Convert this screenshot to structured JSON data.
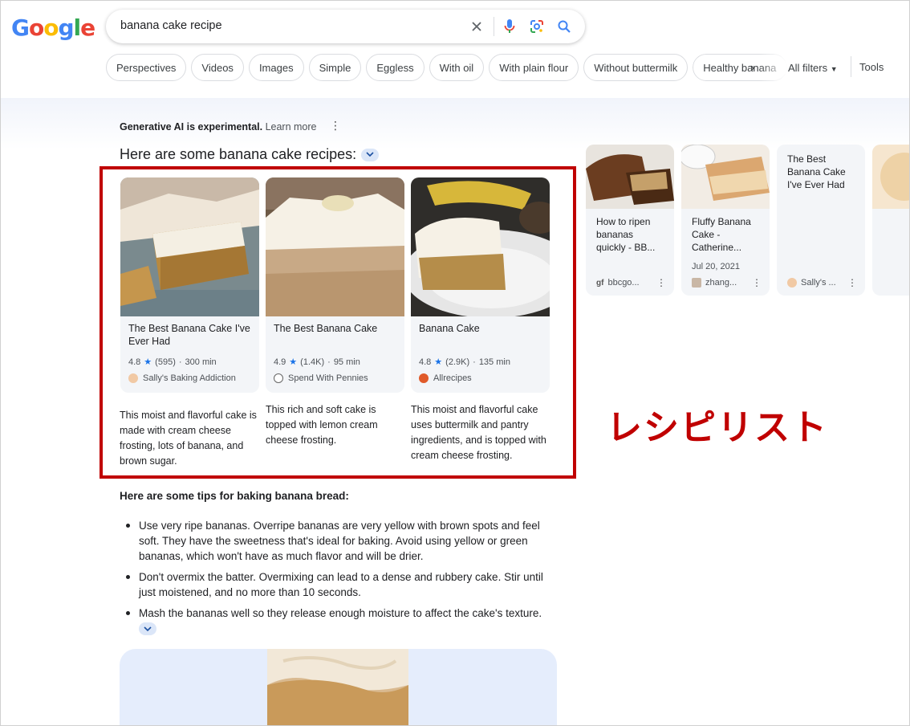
{
  "search": {
    "query": "banana cake recipe"
  },
  "chips": [
    "Perspectives",
    "Videos",
    "Images",
    "Simple",
    "Eggless",
    "With oil",
    "With plain flour",
    "Without buttermilk",
    "Healthy banana"
  ],
  "filters": {
    "all_filters": "All filters",
    "tools": "Tools"
  },
  "ai_overview": {
    "notice_bold": "Generative AI is experimental.",
    "notice_link": "Learn more",
    "heading": "Here are some banana cake recipes:"
  },
  "recipes": [
    {
      "title": "The Best Banana Cake I've Ever Had",
      "rating": "4.8",
      "reviews": "(595)",
      "time": "300 min",
      "source": "Sally's Baking Addiction",
      "description": "This moist and flavorful cake is made with cream cheese frosting, lots of banana, and brown sugar."
    },
    {
      "title": "The Best Banana Cake",
      "rating": "4.9",
      "reviews": "(1.4K)",
      "time": "95 min",
      "source": "Spend With Pennies",
      "description": "This rich and soft cake is topped with lemon cream cheese frosting."
    },
    {
      "title": "Banana Cake",
      "rating": "4.8",
      "reviews": "(2.9K)",
      "time": "135 min",
      "source": "Allrecipes",
      "description": "This moist and flavorful cake uses buttermilk and pantry ingredients, and is topped with cream cheese frosting."
    }
  ],
  "side_cards": [
    {
      "title": "How to ripen bananas quickly - BB...",
      "date": "",
      "source": "bbcgo..."
    },
    {
      "title": "Fluffy Banana Cake - Catherine...",
      "date": "Jul 20, 2021",
      "source": "zhang..."
    },
    {
      "title": "The Best Banana Cake I've Ever Had",
      "date": "",
      "source": "Sally's ..."
    }
  ],
  "tips": {
    "heading": "Here are some tips for baking banana bread:",
    "items": [
      "Use very ripe bananas. Overripe bananas are very yellow with brown spots and feel soft. They have the sweetness that's ideal for baking. Avoid using yellow or green bananas, which won't have as much flavor and will be drier.",
      "Don't overmix the batter. Overmixing can lead to a dense and rubbery cake. Stir until just moistened, and no more than 10 seconds.",
      "Mash the bananas well so they release enough moisture to affect the cake's texture."
    ]
  },
  "annotation": "レシピリスト",
  "colors": {
    "annotation_red": "#c00000",
    "star_blue": "#1a73e8",
    "chip_border": "#dadce0"
  }
}
